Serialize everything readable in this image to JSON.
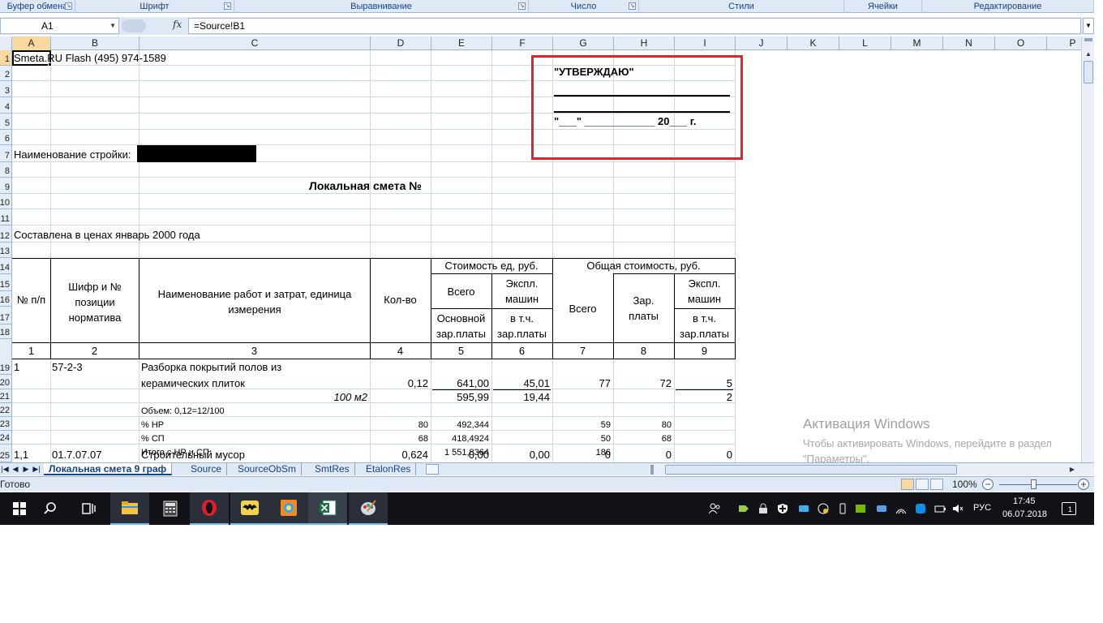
{
  "ribbon": {
    "groups": [
      "Буфер обмена",
      "Шрифт",
      "Выравнивание",
      "Число",
      "Стили",
      "Ячейки",
      "Редактирование"
    ]
  },
  "formula_bar": {
    "name_box": "A1",
    "fx": "fx",
    "formula": "=Source!B1"
  },
  "columns": [
    "A",
    "B",
    "C",
    "D",
    "E",
    "F",
    "G",
    "H",
    "I",
    "J",
    "K",
    "L",
    "M",
    "N",
    "O",
    "P"
  ],
  "rows": [
    "1",
    "2",
    "3",
    "4",
    "5",
    "6",
    "7",
    "8",
    "9",
    "10",
    "11",
    "12",
    "13",
    "14",
    "15",
    "16",
    "17",
    "18",
    "19",
    "20",
    "21",
    "22",
    "23",
    "24",
    "25"
  ],
  "sheet": {
    "a1": "Smeta.RU Flash  (495) 974-1589",
    "approve_title": "\"УТВЕРЖДАЮ\"",
    "approve_date": "\"___\" ____________ 20___ г.",
    "site_label": "Наименование стройки:",
    "title": "Локальная смета №",
    "prices_note": "Составлена в ценах январь 2000 года",
    "headers": {
      "num": "№ п/п",
      "code": "Шифр и № позиции норматива",
      "name": "Наименование работ и затрат, единица измерения",
      "qty": "Кол-во",
      "unit_cost": "Стоимость ед, руб.",
      "total_cost": "Общая стоимость, руб.",
      "all": "Всего",
      "mach_l1": "Экспл.",
      "mach_l2": "машин",
      "base_l1": "Основной",
      "base_l2": "зар.платы",
      "incl_l1": "в т.ч.",
      "incl_l2": "зар.платы",
      "wage_l1": "Зар.",
      "wage_l2": "платы"
    },
    "col_numbers": [
      "1",
      "2",
      "3",
      "4",
      "5",
      "6",
      "7",
      "8",
      "9"
    ],
    "item1": {
      "num": "1",
      "code": "57-2-3",
      "name_l1": "Разборка покрытий полов из",
      "name_l2": "керамических плиток",
      "qty": "0,12",
      "unit_all": "641,00",
      "unit_mach": "45,01",
      "tot_all": "77",
      "tot_wage": "72",
      "tot_mach": "5",
      "unit_measure": "100 м2",
      "unit_base": "595,99",
      "unit_incl": "19,44",
      "tot_mach_incl": "2",
      "volume": "Объем: 0,12=12/100",
      "nr_label": "% НР",
      "nr_pct": "80",
      "nr_unit": "492,344",
      "nr_tot": "59",
      "nr_wage": "80",
      "sp_label": "% СП",
      "sp_pct": "68",
      "sp_unit": "418,4924",
      "sp_tot": "50",
      "sp_wage": "68",
      "sum_label": "Итого с НР и СП",
      "sum_unit": "1 551,8364",
      "sum_tot": "186"
    },
    "item2": {
      "num": "1,1",
      "code": "01.7.07.07",
      "name": "Строительный мусор",
      "qty": "0,624",
      "unit_all": "0,00",
      "unit_mach": "0,00",
      "tot_all": "0",
      "tot_wage": "0",
      "tot_mach": "0"
    }
  },
  "watermark": {
    "title": "Активация Windows",
    "subtitle": "Чтобы активировать Windows, перейдите в раздел \"Параметры\"."
  },
  "tabs": [
    "Локальная смета 9 граф",
    "Source",
    "SourceObSm",
    "SmtRes",
    "EtalonRes"
  ],
  "status": {
    "ready": "Готово",
    "zoom": "100%"
  },
  "taskbar": {
    "lang": "РУС",
    "time": "17:45",
    "date": "06.07.2018",
    "notifications": "1"
  }
}
